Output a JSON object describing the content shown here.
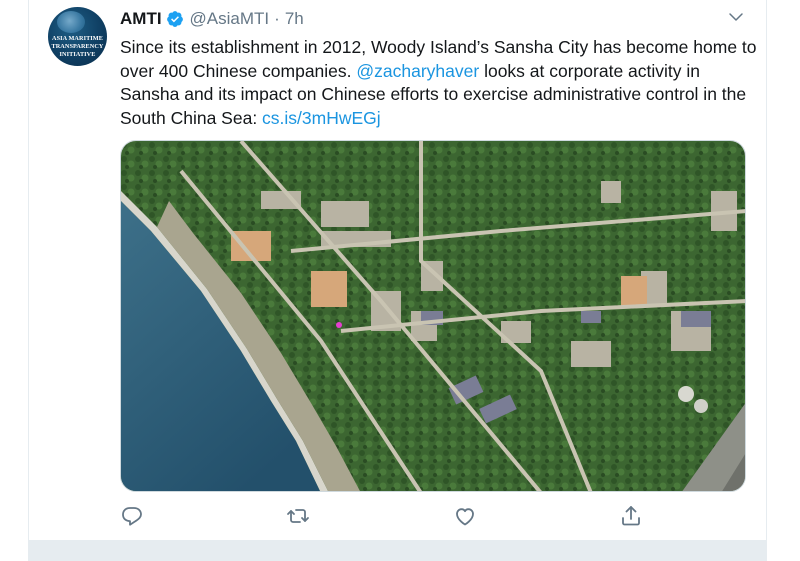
{
  "account": {
    "name": "AMTI",
    "handle": "@AsiaMTI",
    "time": "7h",
    "avatar_text": "ASIA MARITIME\nTRANSPARENCY\nINITIATIVE"
  },
  "tweet": {
    "text_before": "Since its establishment in 2012, Woody Island’s Sansha City has become home to over 400 Chinese companies. ",
    "mention": "@zacharyhaver",
    "text_middle": " looks at corporate activity in Sansha and its impact on Chinese efforts to exercise administrative control in the South China Sea: ",
    "link": "cs.is/3mHwEGj"
  },
  "media": {
    "description_icon": "satellite-image"
  },
  "actions": {
    "reply_icon": "reply-icon",
    "retweet_icon": "retweet-icon",
    "like_icon": "heart-icon",
    "share_icon": "share-icon"
  },
  "colors": {
    "link": "#1b95e0",
    "secondary": "#657786",
    "verified": "#1da1f2",
    "divider": "#e6ecf0",
    "sea": "#2c5c78",
    "land": "#3f6a33"
  }
}
